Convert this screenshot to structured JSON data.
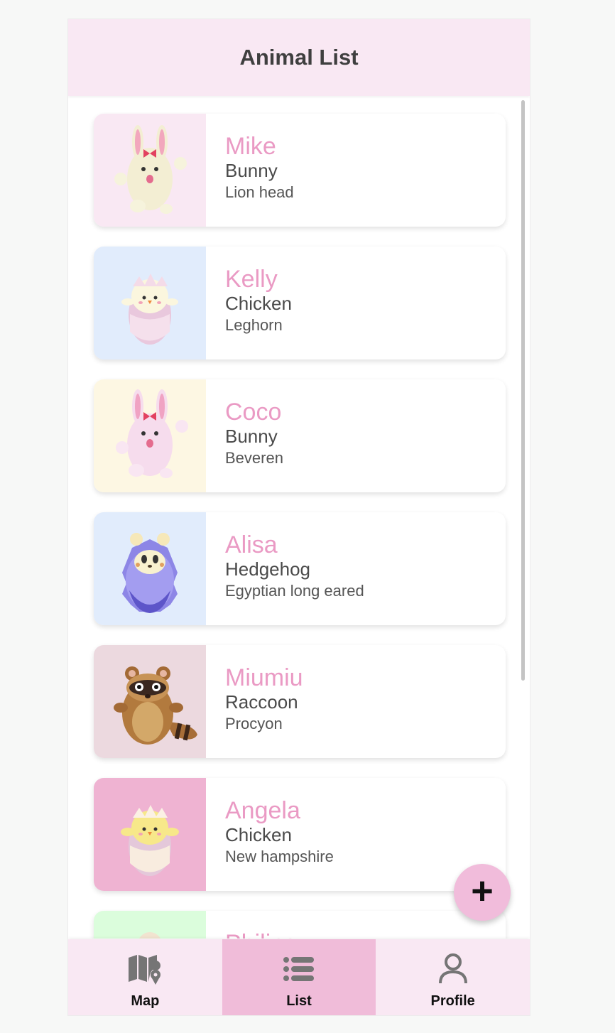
{
  "header": {
    "title": "Animal List"
  },
  "animals": [
    {
      "name": "Mike",
      "species": "Bunny",
      "breed": "Lion head",
      "bg": "#f9e8f3",
      "avatar": "bunny-cream-icon"
    },
    {
      "name": "Kelly",
      "species": "Chicken",
      "breed": "Leghorn",
      "bg": "#e1ecfc",
      "avatar": "chick-white-icon"
    },
    {
      "name": "Coco",
      "species": "Bunny",
      "breed": "Beveren",
      "bg": "#fdf7e3",
      "avatar": "bunny-pink-icon"
    },
    {
      "name": "Alisa",
      "species": "Hedgehog",
      "breed": "Egyptian long eared",
      "bg": "#e1ecfc",
      "avatar": "hedgehog-icon"
    },
    {
      "name": "Miumiu",
      "species": "Raccoon",
      "breed": "Procyon",
      "bg": "#ecd9df",
      "avatar": "raccoon-icon"
    },
    {
      "name": "Angela",
      "species": "Chicken",
      "breed": "New hampshire",
      "bg": "#efb3d2",
      "avatar": "chick-yellow-icon"
    },
    {
      "name": "Philips",
      "species": "",
      "breed": "",
      "bg": "#dbfddc",
      "avatar": "animal-icon"
    }
  ],
  "fab": {
    "label": "+"
  },
  "nav": {
    "items": [
      {
        "label": "Map",
        "icon": "map-icon",
        "active": false
      },
      {
        "label": "List",
        "icon": "list-icon",
        "active": true
      },
      {
        "label": "Profile",
        "icon": "profile-icon",
        "active": false
      }
    ]
  },
  "colors": {
    "accent_pink": "#ea9ac4",
    "header_bg": "#f9e8f3",
    "nav_active_bg": "#f0bcd9",
    "fab_bg": "#f1bcdb"
  }
}
